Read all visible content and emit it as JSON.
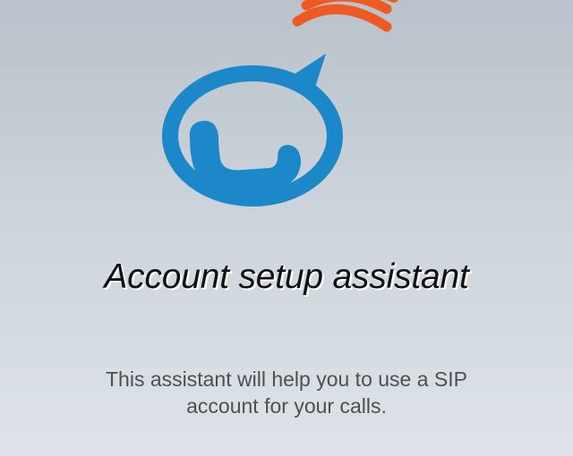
{
  "app": {
    "logo_icon": "sip-phone-bubble-logo-icon",
    "colors": {
      "logo_blue": "#1c87c9",
      "logo_orange": "#ef5a23"
    }
  },
  "assistant": {
    "title": "Account setup assistant",
    "description": "This assistant will help you to use a SIP account for your calls."
  }
}
